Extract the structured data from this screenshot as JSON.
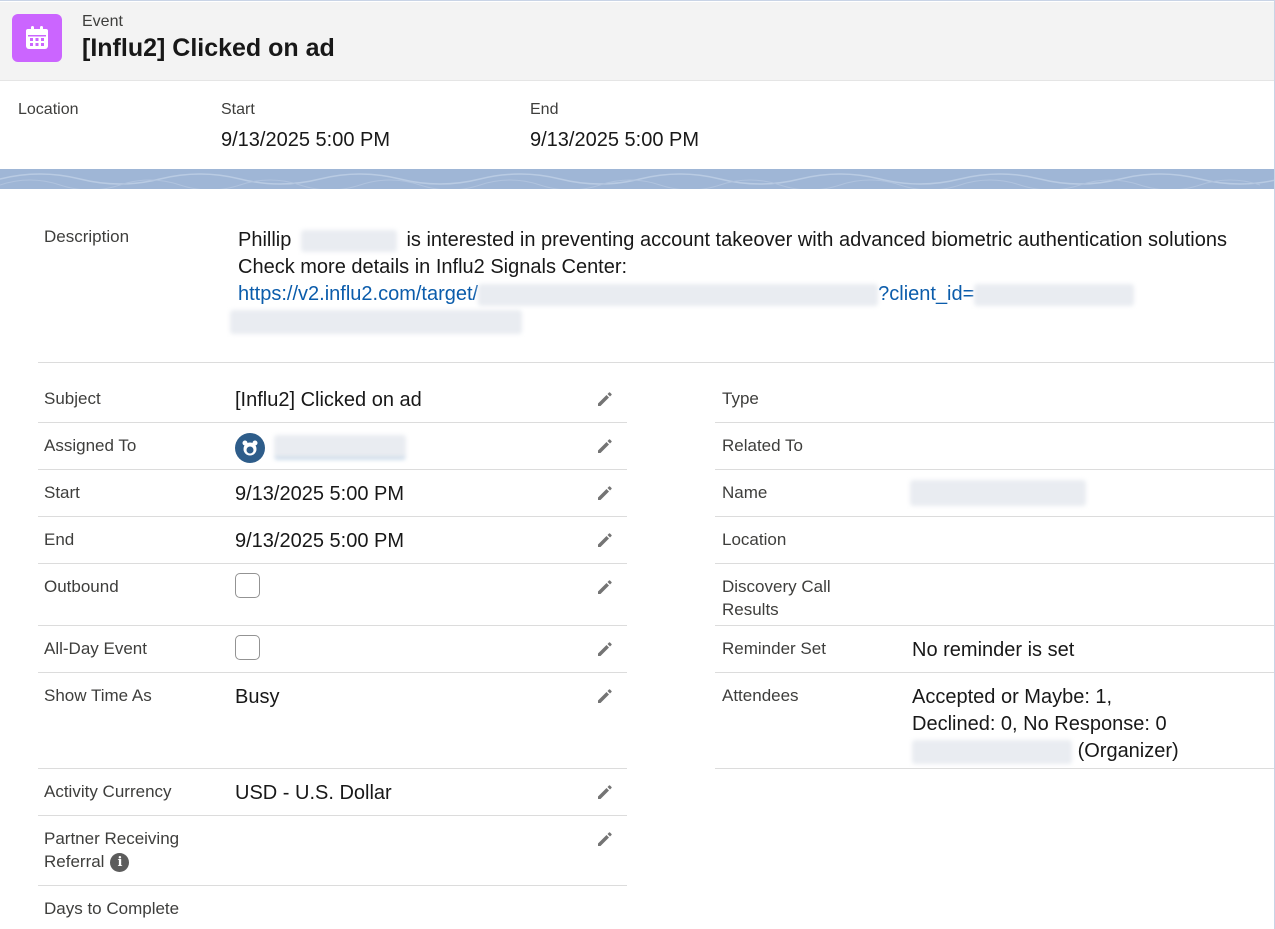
{
  "header": {
    "type_label": "Event",
    "title": "[Influ2] Clicked on ad",
    "icon": "calendar-icon",
    "icon_color": "#cb65ff"
  },
  "highlights": {
    "location_label": "Location",
    "start_label": "Start",
    "start_value": "9/13/2025 5:00 PM",
    "end_label": "End",
    "end_value": "9/13/2025 5:00 PM"
  },
  "description": {
    "label": "Description",
    "name_first": "Phillip",
    "line1_rest": "is interested in preventing account takeover with advanced biometric authentication solutions",
    "line2": "Check more details in Influ2 Signals Center:",
    "link_prefix": "https://v2.influ2.com/target/",
    "link_param": "?client_id="
  },
  "left_fields": {
    "subject": {
      "label": "Subject",
      "value": "[Influ2] Clicked on ad"
    },
    "assigned_to": {
      "label": "Assigned To"
    },
    "start": {
      "label": "Start",
      "value": "9/13/2025 5:00 PM"
    },
    "end": {
      "label": "End",
      "value": "9/13/2025 5:00 PM"
    },
    "outbound": {
      "label": "Outbound"
    },
    "all_day": {
      "label": "All-Day Event"
    },
    "show_time_as": {
      "label": "Show Time As",
      "value": "Busy"
    },
    "activity_currency": {
      "label": "Activity Currency",
      "value": "USD - U.S. Dollar"
    },
    "partner_referral": {
      "label_line1": "Partner Receiving",
      "label_line2": "Referral",
      "info_glyph": "i"
    },
    "days_to_complete": {
      "label": "Days to Complete"
    }
  },
  "right_fields": {
    "type": {
      "label": "Type"
    },
    "related_to": {
      "label": "Related To"
    },
    "name": {
      "label": "Name"
    },
    "location": {
      "label": "Location"
    },
    "discovery": {
      "label_line1": "Discovery Call",
      "label_line2": "Results"
    },
    "reminder": {
      "label": "Reminder Set",
      "value": "No reminder is set"
    },
    "attendees": {
      "label": "Attendees",
      "line1": "Accepted or Maybe: 1,",
      "line2": "Declined: 0, No Response: 0",
      "organizer_suffix": "(Organizer)"
    }
  }
}
